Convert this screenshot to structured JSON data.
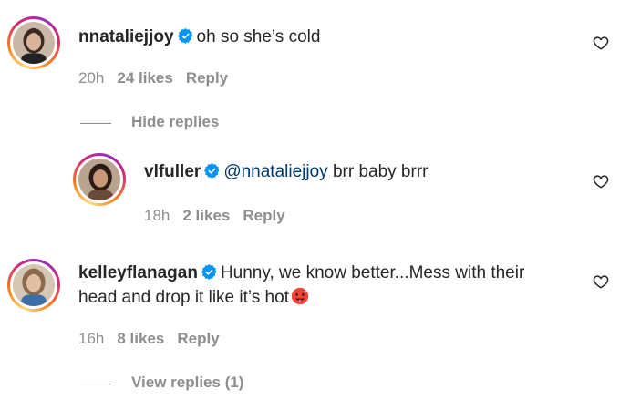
{
  "colors": {
    "text": "#262626",
    "muted": "#8e8e8e",
    "mention": "#00376b",
    "verified": "#0095f6"
  },
  "comments": [
    {
      "username": "nnataliejjoy",
      "text": "oh so she’s cold",
      "time": "20h",
      "likes": "24 likes",
      "reply": "Reply",
      "thread_toggle": "Hide replies"
    },
    {
      "username": "vlfuller",
      "mention": "@nnataliejjoy",
      "text": " brr baby brrr",
      "time": "18h",
      "likes": "2 likes",
      "reply": "Reply"
    },
    {
      "username": "kelleyflanagan",
      "text": "Hunny, we know better...Mess with their",
      "text2": "head and drop it like it’s hot",
      "emoji": "hot-face-emoji",
      "time": "16h",
      "likes": "8 likes",
      "reply": "Reply",
      "thread_toggle": "View replies (1)"
    }
  ],
  "icons": {
    "verified": "verified-badge-icon",
    "like": "heart-icon"
  }
}
